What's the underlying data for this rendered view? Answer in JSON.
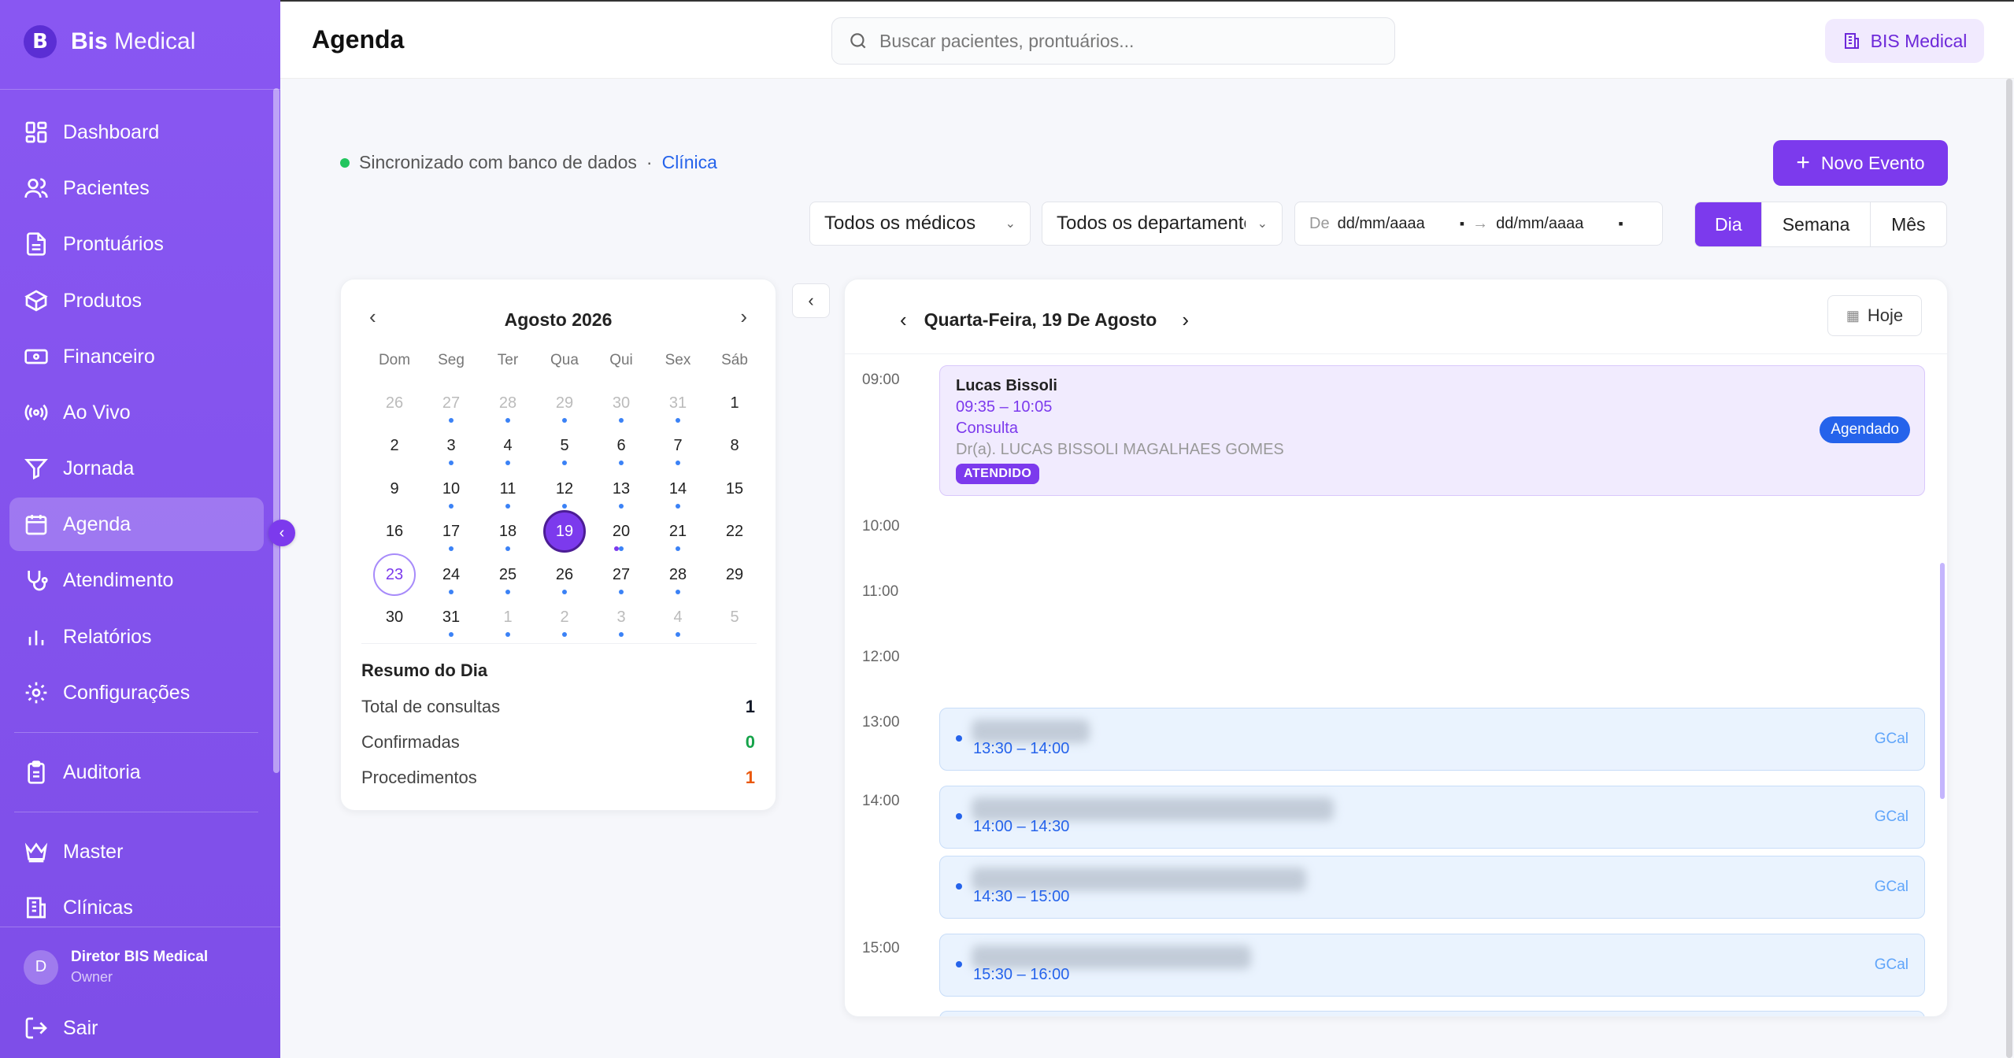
{
  "app": {
    "brand_bold": "Bis",
    "brand_light": "Medical"
  },
  "sidebar": {
    "items": [
      {
        "label": "Dashboard",
        "icon": "dashboard-icon"
      },
      {
        "label": "Pacientes",
        "icon": "users-icon"
      },
      {
        "label": "Prontuários",
        "icon": "document-icon"
      },
      {
        "label": "Produtos",
        "icon": "box-icon"
      },
      {
        "label": "Financeiro",
        "icon": "money-icon"
      },
      {
        "label": "Ao Vivo",
        "icon": "broadcast-icon"
      },
      {
        "label": "Jornada",
        "icon": "funnel-icon"
      },
      {
        "label": "Agenda",
        "icon": "calendar-icon"
      },
      {
        "label": "Atendimento",
        "icon": "stethoscope-icon"
      },
      {
        "label": "Relatórios",
        "icon": "bar-chart-icon"
      },
      {
        "label": "Configurações",
        "icon": "gear-icon"
      },
      {
        "label": "Auditoria",
        "icon": "clipboard-icon"
      },
      {
        "label": "Master",
        "icon": "crown-icon"
      },
      {
        "label": "Clínicas",
        "icon": "building-icon"
      }
    ],
    "active": "Agenda",
    "user": {
      "initial": "D",
      "name": "Diretor BIS Medical",
      "role": "Owner"
    },
    "logout": "Sair"
  },
  "header": {
    "title": "Agenda",
    "search_placeholder": "Buscar pacientes, prontuários...",
    "clinic": "BIS Medical"
  },
  "toolbar": {
    "sync_text": "Sincronizado com banco de dados",
    "sync_sep": "·",
    "sync_link": "Clínica",
    "new_event": "Novo Evento",
    "doctors_select": "Todos os médicos",
    "departments_select": "Todos os departamentos",
    "date_from_label": "De",
    "date_from": "dd/mm/aaaa",
    "date_arrow": "→",
    "date_to": "dd/mm/aaaa",
    "views": [
      "Dia",
      "Semana",
      "Mês"
    ],
    "active_view": "Dia"
  },
  "calendar": {
    "month_label": "Agosto 2026",
    "weekdays": [
      "Dom",
      "Seg",
      "Ter",
      "Qua",
      "Qui",
      "Sex",
      "Sáb"
    ],
    "weeks": [
      [
        "26",
        "27",
        "28",
        "29",
        "30",
        "31",
        "1"
      ],
      [
        "2",
        "3",
        "4",
        "5",
        "6",
        "7",
        "8"
      ],
      [
        "9",
        "10",
        "11",
        "12",
        "13",
        "14",
        "15"
      ],
      [
        "16",
        "17",
        "18",
        "19",
        "20",
        "21",
        "22"
      ],
      [
        "23",
        "24",
        "25",
        "26",
        "27",
        "28",
        "29"
      ],
      [
        "30",
        "31",
        "1",
        "2",
        "3",
        "4",
        "5"
      ]
    ],
    "selected": "19",
    "today": "23",
    "summary": {
      "title": "Resumo do Dia",
      "rows": [
        {
          "label": "Total de consultas",
          "value": "1",
          "color": "#111827"
        },
        {
          "label": "Confirmadas",
          "value": "0",
          "color": "#16a34a"
        },
        {
          "label": "Procedimentos",
          "value": "1",
          "color": "#ea580c"
        }
      ]
    }
  },
  "dayview": {
    "title": "Quarta-Feira, 19 De Agosto",
    "today_button": "Hoje",
    "hours": [
      "09:00",
      "10:00",
      "11:00",
      "12:00",
      "13:00",
      "14:00",
      "15:00"
    ],
    "main_event": {
      "patient": "Lucas Bissoli",
      "time": "09:35 – 10:05",
      "type": "Consulta",
      "doctor": "Dr(a). LUCAS BISSOLI MAGALHAES GOMES",
      "status_tag": "ATENDIDO",
      "status_badge": "Agendado"
    },
    "gcal_events": [
      {
        "time": "13:30 – 14:00",
        "source": "GCal"
      },
      {
        "time": "14:00 – 14:30",
        "source": "GCal"
      },
      {
        "time": "14:30 – 15:00",
        "source": "GCal"
      },
      {
        "time": "15:30 – 16:00",
        "source": "GCal"
      }
    ]
  },
  "colors": {
    "accent": "#7c3aed",
    "sidebar": "#8957f2",
    "blue": "#2563eb"
  }
}
